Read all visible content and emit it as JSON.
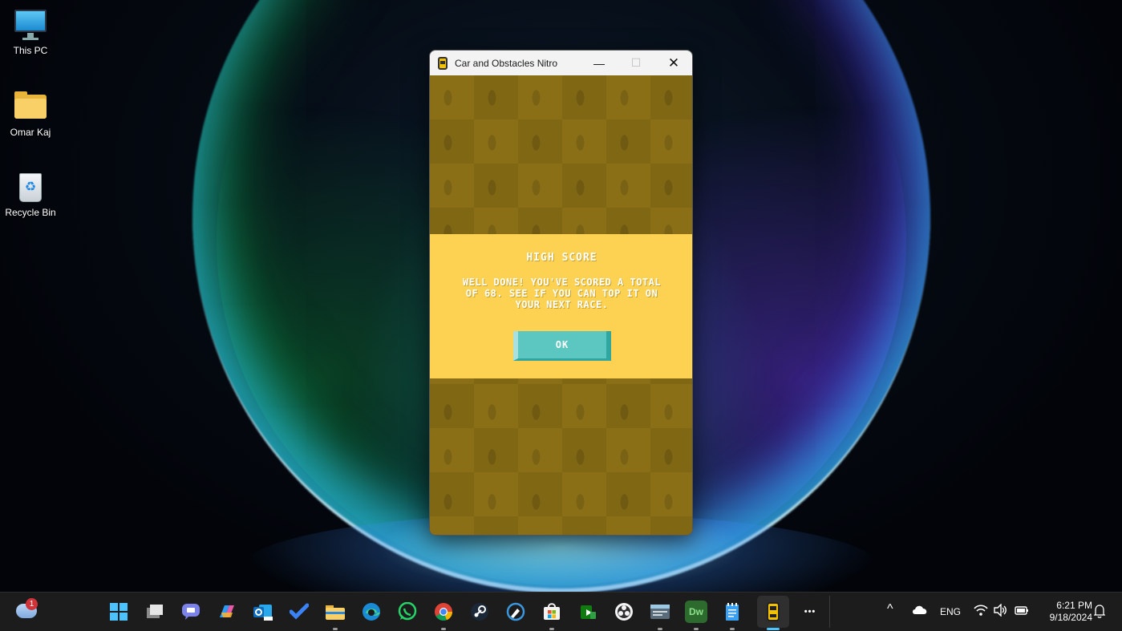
{
  "desktop": {
    "icons": [
      {
        "label": "This PC",
        "icon": "monitor-icon"
      },
      {
        "label": "Omar Kaj",
        "icon": "folder-icon"
      },
      {
        "label": "Recycle Bin",
        "icon": "recycle-bin-icon"
      }
    ]
  },
  "window": {
    "title": "Car and Obstacles Nitro",
    "minimize_glyph": "—",
    "maximize_glyph": "☐",
    "close_glyph": "✕"
  },
  "dialog": {
    "title": "HIGH SCORE",
    "message": "WELL DONE! YOU'VE SCORED A TOTAL OF 68. SEE IF YOU CAN TOP IT ON YOUR NEXT RACE.",
    "ok_label": "OK",
    "background_color": "#fdd152",
    "button_color": "#5cc6c0"
  },
  "taskbar": {
    "weather_badge": "1",
    "apps": [
      "start-icon",
      "task-view-icon",
      "teams-chat-icon",
      "copilot-icon",
      "outlook-icon",
      "todo-icon",
      "file-explorer-icon",
      "edge-icon",
      "whatsapp-icon",
      "chrome-icon",
      "steam-icon",
      "paint-icon",
      "store-icon",
      "game-icon",
      "obs-icon",
      "terminal-icon",
      "dreamweaver-icon",
      "notepad-icon",
      "car-game-icon"
    ],
    "dreamweaver_text": "Dw",
    "more_glyph": "•••",
    "tray": {
      "chevron": "^",
      "language": "ENG",
      "time": "6:21 PM",
      "date": "9/18/2024"
    }
  }
}
